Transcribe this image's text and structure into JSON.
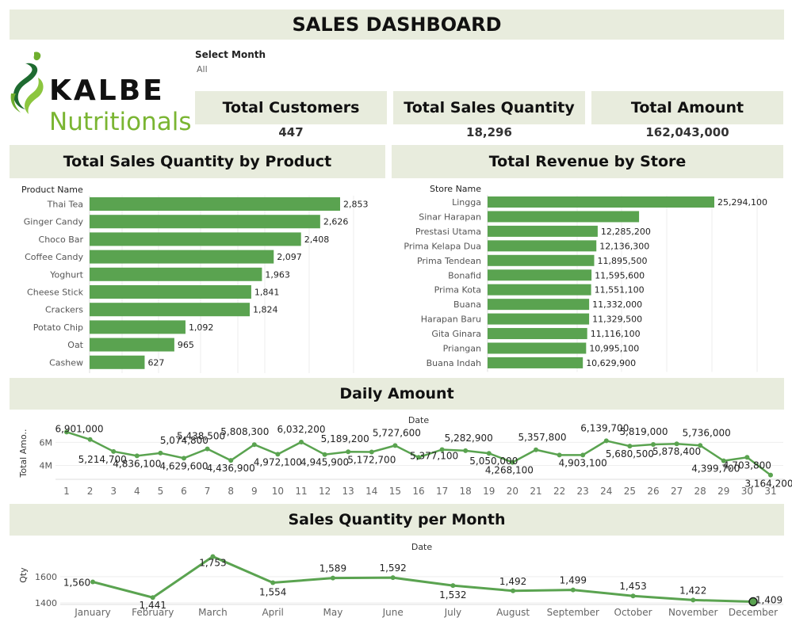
{
  "header": {
    "title": "SALES DASHBOARD"
  },
  "logo": {
    "brand": "KALBE",
    "sub": "Nutritionals"
  },
  "filter": {
    "label": "Select Month",
    "value": "All"
  },
  "kpis": [
    {
      "label": "Total Customers",
      "value": "447"
    },
    {
      "label": "Total Sales Quantity",
      "value": "18,296"
    },
    {
      "label": "Total Amount",
      "value": "162,043,000"
    }
  ],
  "colors": {
    "band": "#e8ecdd",
    "bar": "#5aa350",
    "line": "#5aa350"
  },
  "chart_data": [
    {
      "type": "bar",
      "title": "Total Sales Quantity by Product",
      "axis_label": "Product Name",
      "categories": [
        "Thai Tea",
        "Ginger Candy",
        "Choco Bar",
        "Coffee Candy",
        "Yoghurt",
        "Cheese Stick",
        "Crackers",
        "Potato Chip",
        "Oat",
        "Cashew"
      ],
      "values": [
        2853,
        2626,
        2408,
        2097,
        1963,
        1841,
        1824,
        1092,
        965,
        627
      ],
      "labels": [
        "2,853",
        "2,626",
        "2,408",
        "2,097",
        "1,963",
        "1,841",
        "1,824",
        "1,092",
        "965",
        "627"
      ]
    },
    {
      "type": "bar",
      "title": "Total Revenue by Store",
      "axis_label": "Store Name",
      "categories": [
        "Lingga",
        "Sinar Harapan",
        "Prestasi Utama",
        "Prima Kelapa Dua",
        "Prima Tendean",
        "Bonafid",
        "Prima Kota",
        "Buana",
        "Harapan Baru",
        "Gita Ginara",
        "Priangan",
        "Buana Indah"
      ],
      "values": [
        25294100,
        16900000,
        12285200,
        12136300,
        11895500,
        11595600,
        11551100,
        11332000,
        11329500,
        11116100,
        10995100,
        10629900
      ],
      "labels": [
        "25,294,100",
        "",
        "12,285,200",
        "12,136,300",
        "11,895,500",
        "11,595,600",
        "11,551,100",
        "11,332,000",
        "11,329,500",
        "11,116,100",
        "10,995,100",
        "10,629,900"
      ]
    },
    {
      "type": "line",
      "title": "Daily Amount",
      "xlabel": "Date",
      "ylabel": "Total Amo..",
      "x": [
        1,
        2,
        3,
        4,
        5,
        6,
        7,
        8,
        9,
        10,
        11,
        12,
        13,
        14,
        15,
        16,
        17,
        18,
        19,
        20,
        21,
        22,
        23,
        24,
        25,
        26,
        27,
        28,
        29,
        30,
        31
      ],
      "values": [
        6901000,
        6250000,
        5214700,
        4836100,
        5074800,
        4629600,
        5438500,
        4436900,
        5808300,
        4972100,
        6032200,
        4945900,
        5189200,
        5172700,
        5727600,
        4700000,
        5377100,
        5282900,
        5050000,
        4268100,
        5357800,
        4903100,
        4903100,
        6139700,
        5680500,
        5819000,
        5878400,
        5736000,
        4399700,
        4703800,
        3164200
      ],
      "labels": [
        "6,901,000",
        "",
        "5,214,700",
        "4,836,100",
        "5,074,800",
        "4,629,600",
        "5,438,500",
        "4,436,900",
        "5,808,300",
        "4,972,100",
        "6,032,200",
        "4,945,900",
        "5,189,200",
        "5,172,700",
        "5,727,600",
        "",
        "5,377,100",
        "5,282,900",
        "5,050,000",
        "4,268,100",
        "5,357,800",
        "",
        "4,903,100",
        "6,139,700",
        "5,680,500",
        "5,819,000",
        "5,878,400",
        "5,736,000",
        "4,399,700",
        "4,703,800",
        "3,164,200"
      ],
      "yticks": [
        "6M",
        "4M"
      ],
      "ytick_values": [
        6000000,
        4000000
      ],
      "ylim": [
        3000000,
        7200000
      ]
    },
    {
      "type": "line",
      "title": "Sales Quantity per Month",
      "xlabel": "Date",
      "ylabel": "Qty",
      "categories": [
        "January",
        "February",
        "March",
        "April",
        "May",
        "June",
        "July",
        "August",
        "September",
        "October",
        "November",
        "December"
      ],
      "values": [
        1560,
        1441,
        1753,
        1554,
        1589,
        1592,
        1532,
        1492,
        1499,
        1453,
        1422,
        1409
      ],
      "labels": [
        "1,560",
        "1,441",
        "1,753",
        "1,554",
        "1,589",
        "1,592",
        "1,532",
        "1,492",
        "1,499",
        "1,453",
        "1,422",
        "1,409"
      ],
      "yticks": [
        "1600",
        "1400"
      ],
      "ytick_values": [
        1600,
        1400
      ],
      "ylim": [
        1370,
        1780
      ]
    }
  ]
}
